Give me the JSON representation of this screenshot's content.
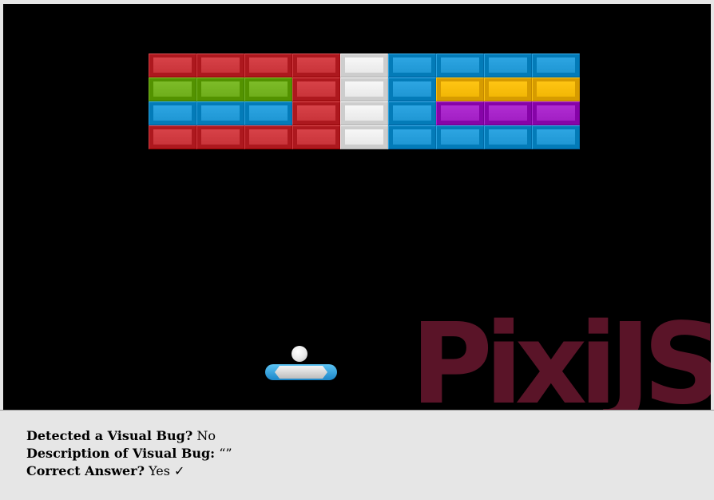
{
  "game": {
    "watermark": "PixiJS",
    "colors": {
      "background": "#000000",
      "red": "#c9343a",
      "green": "#6fae1b",
      "blue": "#1f97d4",
      "white": "#e9e9e9",
      "yellow": "#f2b705",
      "purple": "#a21fc4",
      "watermark": "#5a1428"
    },
    "brick_grid": [
      [
        "red",
        "red",
        "red",
        "red",
        "white",
        "blue",
        "blue",
        "blue",
        "blue"
      ],
      [
        "green",
        "green",
        "green",
        "red",
        "white",
        "blue",
        "yellow",
        "yellow",
        "yellow"
      ],
      [
        "blue",
        "blue",
        "blue",
        "red",
        "white",
        "blue",
        "purple",
        "purple",
        "purple"
      ],
      [
        "red",
        "red",
        "red",
        "red",
        "white",
        "blue",
        "blue",
        "blue",
        "blue"
      ]
    ]
  },
  "report": {
    "detected_label": "Detected a Visual Bug?",
    "detected_value": "No",
    "description_label": "Description of Visual Bug:",
    "description_value": "“”",
    "correct_label": "Correct Answer?",
    "correct_value": "Yes ✓"
  }
}
